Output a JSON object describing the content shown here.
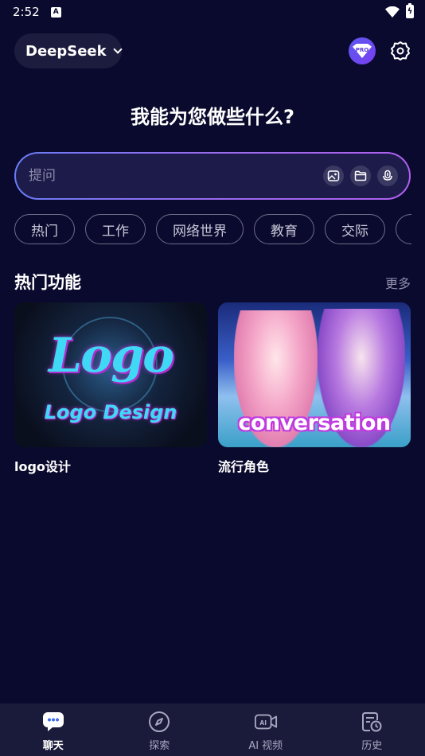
{
  "status": {
    "time": "2:52",
    "indicator": "A"
  },
  "header": {
    "model_name": "DeepSeek",
    "pro_label": "PRO"
  },
  "headline": "我能为您做些什么?",
  "prompt": {
    "placeholder": "提问"
  },
  "chips": [
    "热门",
    "工作",
    "网络世界",
    "教育",
    "交际"
  ],
  "section": {
    "title": "热门功能",
    "more": "更多"
  },
  "cards": [
    {
      "label": "logo设计",
      "image_title": "Logo",
      "image_subtitle": "Logo Design"
    },
    {
      "label": "流行角色",
      "image_title": "conversation"
    }
  ],
  "nav": [
    {
      "label": "聊天",
      "icon": "chat-icon",
      "active": true
    },
    {
      "label": "探索",
      "icon": "compass-icon",
      "active": false
    },
    {
      "label": "AI 视频",
      "icon": "ai-video-icon",
      "active": false
    },
    {
      "label": "历史",
      "icon": "history-icon",
      "active": false
    }
  ],
  "colors": {
    "background": "#0a0a2e",
    "accent": "#6a5cf0"
  }
}
